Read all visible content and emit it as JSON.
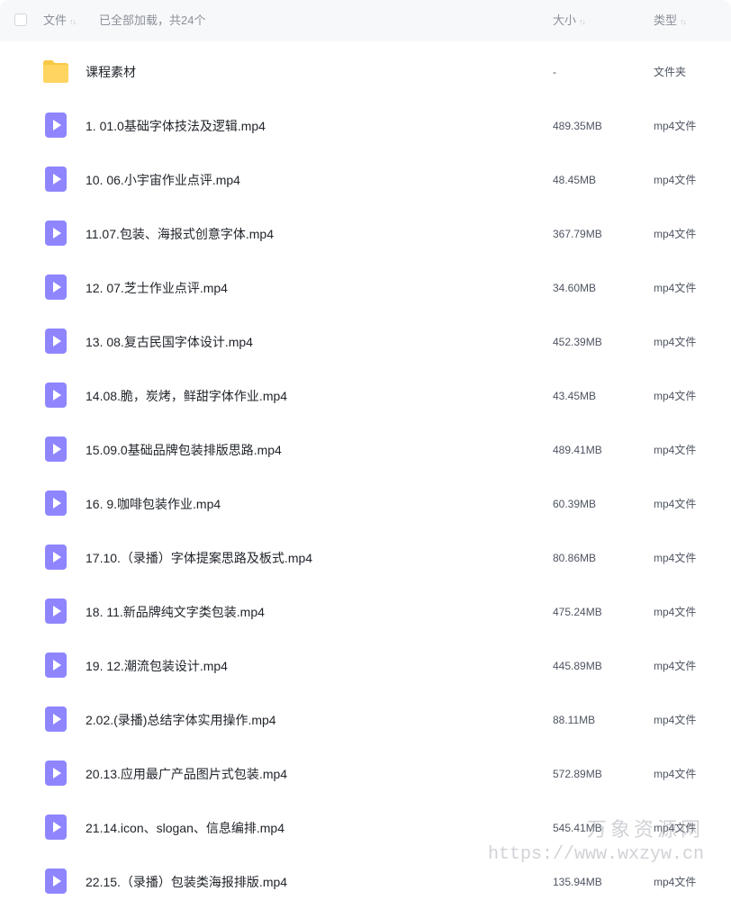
{
  "header": {
    "name_label": "文件",
    "status_text": "已全部加载，共24个",
    "size_label": "大小",
    "type_label": "类型",
    "sort_icon": "↑↓"
  },
  "icons": {
    "folder": "folder-icon",
    "video": "video-file-icon",
    "folder_color": "#ffd460",
    "video_color": "#8f86ff"
  },
  "files": [
    {
      "name": "课程素材",
      "size": "-",
      "type": "文件夹",
      "kind": "folder"
    },
    {
      "name": "1. 01.0基础字体技法及逻辑.mp4",
      "size": "489.35MB",
      "type": "mp4文件",
      "kind": "video"
    },
    {
      "name": "10. 06.小宇宙作业点评.mp4",
      "size": "48.45MB",
      "type": "mp4文件",
      "kind": "video"
    },
    {
      "name": "11.07.包装、海报式创意字体.mp4",
      "size": "367.79MB",
      "type": "mp4文件",
      "kind": "video"
    },
    {
      "name": "12. 07.芝士作业点评.mp4",
      "size": "34.60MB",
      "type": "mp4文件",
      "kind": "video"
    },
    {
      "name": "13. 08.复古民国字体设计.mp4",
      "size": "452.39MB",
      "type": "mp4文件",
      "kind": "video"
    },
    {
      "name": "14.08.脆，炭烤，鲜甜字体作业.mp4",
      "size": "43.45MB",
      "type": "mp4文件",
      "kind": "video"
    },
    {
      "name": "15.09.0基础品牌包装排版思路.mp4",
      "size": "489.41MB",
      "type": "mp4文件",
      "kind": "video"
    },
    {
      "name": "16. 9.咖啡包装作业.mp4",
      "size": "60.39MB",
      "type": "mp4文件",
      "kind": "video"
    },
    {
      "name": "17.10.（录播）字体提案思路及板式.mp4",
      "size": "80.86MB",
      "type": "mp4文件",
      "kind": "video"
    },
    {
      "name": "18. 11.新品牌纯文字类包装.mp4",
      "size": "475.24MB",
      "type": "mp4文件",
      "kind": "video"
    },
    {
      "name": "19. 12.潮流包装设计.mp4",
      "size": "445.89MB",
      "type": "mp4文件",
      "kind": "video"
    },
    {
      "name": "2.02.(录播)总结字体实用操作.mp4",
      "size": "88.11MB",
      "type": "mp4文件",
      "kind": "video"
    },
    {
      "name": "20.13.应用最广产品图片式包装.mp4",
      "size": "572.89MB",
      "type": "mp4文件",
      "kind": "video"
    },
    {
      "name": "21.14.icon、slogan、信息编排.mp4",
      "size": "545.41MB",
      "type": "mp4文件",
      "kind": "video"
    },
    {
      "name": "22.15.（录播）包装类海报排版.mp4",
      "size": "135.94MB",
      "type": "mp4文件",
      "kind": "video"
    }
  ],
  "watermark": {
    "text": "万象资源网",
    "url": "https://www.wxzyw.cn"
  }
}
